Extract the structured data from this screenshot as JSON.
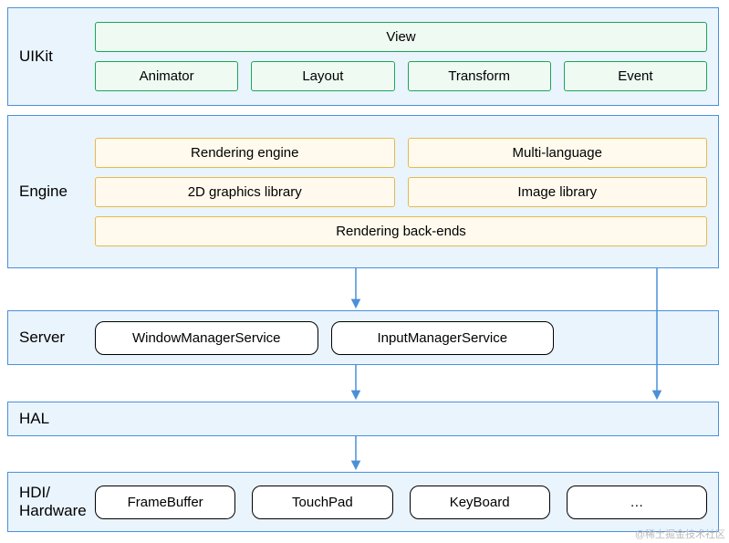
{
  "uikit": {
    "title": "UIKit",
    "view": "View",
    "row": [
      "Animator",
      "Layout",
      "Transform",
      "Event"
    ]
  },
  "engine": {
    "title": "Engine",
    "row1": [
      "Rendering engine",
      "Multi-language"
    ],
    "row2": [
      "2D graphics library",
      "Image library"
    ],
    "row3": "Rendering back-ends"
  },
  "server": {
    "title": "Server",
    "items": [
      "WindowManagerService",
      "InputManagerService"
    ]
  },
  "hal": {
    "title": "HAL"
  },
  "hardware": {
    "title": "HDI/\nHardware",
    "items": [
      "FrameBuffer",
      "TouchPad",
      "KeyBoard",
      "…"
    ]
  },
  "watermark": "@稀土掘金技术社区"
}
